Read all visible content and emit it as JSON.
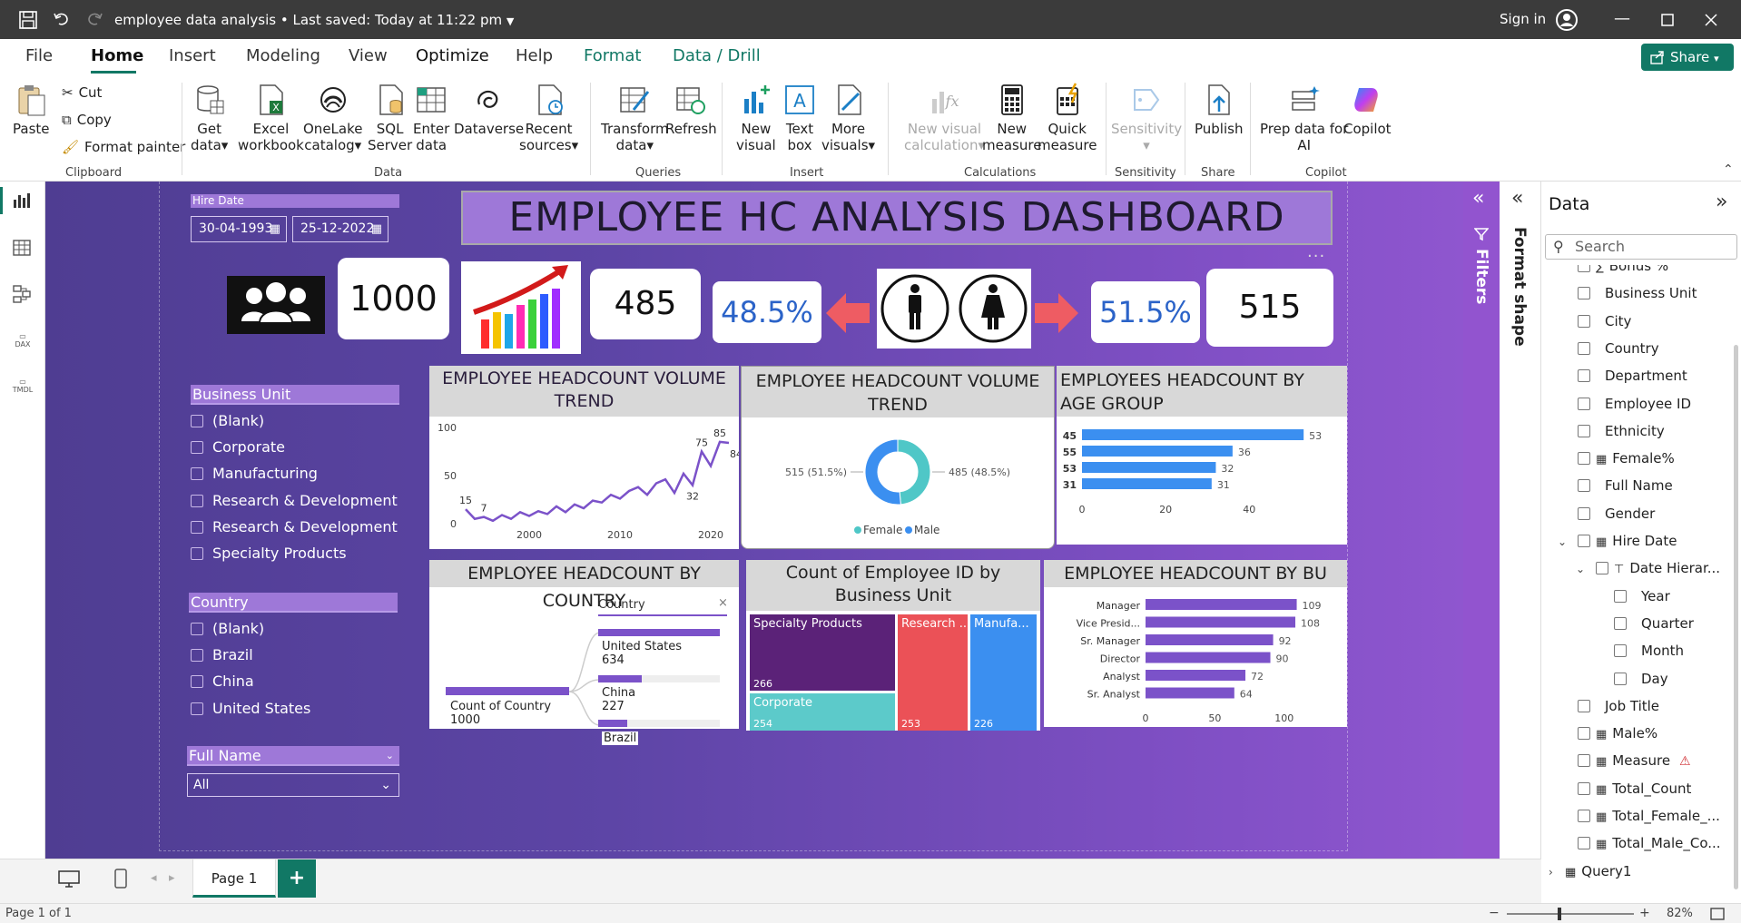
{
  "titlebar": {
    "title": "employee data analysis",
    "saved": "Last saved: Today at 11:22 pm",
    "signin": "Sign in"
  },
  "tabs": [
    "File",
    "Home",
    "Insert",
    "Modeling",
    "View",
    "Optimize",
    "Help",
    "Format",
    "Data / Drill"
  ],
  "share_label": "Share",
  "ribbon": {
    "clipboard": {
      "paste": "Paste",
      "cut": "Cut",
      "copy": "Copy",
      "format_painter": "Format painter",
      "group": "Clipboard"
    },
    "data": {
      "get_data_1": "Get",
      "get_data_2": "data",
      "excel_1": "Excel",
      "excel_2": "workbook",
      "onelake_1": "OneLake",
      "onelake_2": "catalog",
      "sql_1": "SQL",
      "sql_2": "Server",
      "enter_1": "Enter",
      "enter_2": "data",
      "dataverse": "Dataverse",
      "recent_1": "Recent",
      "recent_2": "sources",
      "group": "Data"
    },
    "queries": {
      "transform_1": "Transform",
      "transform_2": "data",
      "refresh": "Refresh",
      "group": "Queries"
    },
    "insert": {
      "newvisual_1": "New",
      "newvisual_2": "visual",
      "textbox_1": "Text",
      "textbox_2": "box",
      "more_1": "More",
      "more_2": "visuals",
      "group": "Insert"
    },
    "calculations": {
      "nvc_1": "New visual",
      "nvc_2": "calculation",
      "nm_1": "New",
      "nm_2": "measure",
      "qm_1": "Quick",
      "qm_2": "measure",
      "group": "Calculations"
    },
    "sensitivity": {
      "label": "Sensitivity",
      "group": "Sensitivity"
    },
    "share": {
      "publish": "Publish",
      "group": "Share"
    },
    "copilot": {
      "prep_1": "Prep data for",
      "prep_2": "AI",
      "copilot": "Copilot",
      "group": "Copilot"
    }
  },
  "dashboard": {
    "title": "EMPLOYEE HC ANALYSIS DASHBOARD",
    "hire_date": {
      "label": "Hire Date",
      "from": "30-04-1993",
      "to": "25-12-2022"
    },
    "kpi": {
      "total": "1000",
      "female": "485",
      "female_pct": "48.5%",
      "male_pct": "51.5%",
      "male": "515"
    },
    "bu_slicer": {
      "title": "Business Unit",
      "items": [
        "(Blank)",
        "Corporate",
        "Manufacturing",
        "Research & Development",
        "Research & Development",
        "Specialty Products"
      ]
    },
    "country_slicer": {
      "title": "Country",
      "items": [
        "(Blank)",
        "Brazil",
        "China",
        "United States"
      ]
    },
    "fullname_slicer": {
      "title": "Full Name",
      "value": "All"
    },
    "v_line_title": "EMPLOYEE HEADCOUNT VOLUME TREND",
    "v_donut_title": "EMPLOYEE HEADCOUNT VOLUME TREND",
    "v_age_title": "EMPLOYEES HEADCOUNT BY AGE GROUP",
    "v_country_title": "EMPLOYEE HEADCOUNT BY COUNTRY",
    "v_treemap_title": "Count of Employee ID by Business Unit",
    "v_bu_title": "EMPLOYEE HEADCOUNT BY BU",
    "decomp": {
      "filter": "Country",
      "root_label": "Count of Country",
      "root_value": "1000",
      "n1_label": "United States",
      "n1_value": "634",
      "n2_label": "China",
      "n2_value": "227",
      "n3_label": "Brazil"
    }
  },
  "chart_data": [
    {
      "type": "line",
      "ylim": [
        0,
        100
      ],
      "yticks": [
        "0",
        "50",
        "100"
      ],
      "xticks": [
        "2000",
        "2010",
        "2020"
      ],
      "x": [
        1993,
        1994,
        1995,
        1996,
        1997,
        1998,
        1999,
        2000,
        2001,
        2002,
        2003,
        2004,
        2005,
        2006,
        2007,
        2008,
        2009,
        2010,
        2011,
        2012,
        2013,
        2014,
        2015,
        2016,
        2017,
        2018,
        2019,
        2020,
        2021,
        2022
      ],
      "values": [
        15,
        5,
        7,
        3,
        9,
        5,
        12,
        8,
        13,
        10,
        18,
        12,
        20,
        16,
        24,
        22,
        30,
        26,
        34,
        38,
        30,
        42,
        46,
        32,
        52,
        40,
        75,
        60,
        85,
        84
      ],
      "labels": [
        {
          "i": 0,
          "text": "15"
        },
        {
          "i": 2,
          "text": "7"
        },
        {
          "i": 25,
          "text": "32"
        },
        {
          "i": 26,
          "text": "75"
        },
        {
          "i": 28,
          "text": "85"
        },
        {
          "i": 29,
          "text": "84"
        }
      ],
      "color": "#7b52c9"
    },
    {
      "type": "pie",
      "hole": true,
      "slices": [
        {
          "name": "Female",
          "value": 485,
          "label": "485 (48.5%)",
          "color": "#4fc7c7"
        },
        {
          "name": "Male",
          "value": 515,
          "label": "515 (51.5%)",
          "color": "#3b8ff0"
        }
      ]
    },
    {
      "type": "bar",
      "orientation": "horizontal",
      "categories": [
        "45",
        "55",
        "53",
        "31"
      ],
      "values": [
        53,
        36,
        32,
        31
      ],
      "xticks": [
        "0",
        "20",
        "40"
      ],
      "xlim": [
        0,
        56
      ],
      "color": "#3b8ff0"
    },
    {
      "type": "heatmap",
      "subtype": "treemap",
      "categories": [
        "Specialty Products",
        "Research ...",
        "Manufa...",
        "Corporate"
      ],
      "values": [
        266,
        253,
        226,
        254
      ],
      "colors": [
        "#5b2278",
        "#eb5157",
        "#3b8ff0",
        "#5ccaca"
      ]
    },
    {
      "type": "bar",
      "orientation": "horizontal",
      "categories": [
        "Manager",
        "Vice Presid...",
        "Sr. Manager",
        "Director",
        "Analyst",
        "Sr. Analyst"
      ],
      "values": [
        109,
        108,
        92,
        90,
        72,
        64
      ],
      "xticks": [
        "0",
        "50",
        "100"
      ],
      "xlim": [
        0,
        125
      ],
      "color": "#7b52c9"
    }
  ],
  "datapane": {
    "title": "Data",
    "search": "Search",
    "fields": [
      {
        "label": "Bonus %",
        "kind": "sigma",
        "indent": 0
      },
      {
        "label": "Business Unit",
        "kind": "",
        "indent": 0
      },
      {
        "label": "City",
        "kind": "",
        "indent": 0
      },
      {
        "label": "Country",
        "kind": "",
        "indent": 0
      },
      {
        "label": "Department",
        "kind": "",
        "indent": 0
      },
      {
        "label": "Employee ID",
        "kind": "",
        "indent": 0
      },
      {
        "label": "Ethnicity",
        "kind": "",
        "indent": 0
      },
      {
        "label": "Female%",
        "kind": "calc",
        "indent": 0
      },
      {
        "label": "Full Name",
        "kind": "",
        "indent": 0
      },
      {
        "label": "Gender",
        "kind": "",
        "indent": 0
      },
      {
        "label": "Hire Date",
        "kind": "table",
        "indent": 0,
        "expand": true
      },
      {
        "label": "Date Hierar...",
        "kind": "hier",
        "indent": 1,
        "expand": true
      },
      {
        "label": "Year",
        "kind": "",
        "indent": 2
      },
      {
        "label": "Quarter",
        "kind": "",
        "indent": 2
      },
      {
        "label": "Month",
        "kind": "",
        "indent": 2
      },
      {
        "label": "Day",
        "kind": "",
        "indent": 2
      },
      {
        "label": "Job Title",
        "kind": "",
        "indent": 0
      },
      {
        "label": "Male%",
        "kind": "calc",
        "indent": 0
      },
      {
        "label": "Measure",
        "kind": "calc",
        "indent": 0,
        "warn": true
      },
      {
        "label": "Total_Count",
        "kind": "calc",
        "indent": 0
      },
      {
        "label": "Total_Female_...",
        "kind": "calc",
        "indent": 0
      },
      {
        "label": "Total_Male_Co...",
        "kind": "calc",
        "indent": 0
      }
    ],
    "query": "Query1"
  },
  "filters_label": "Filters",
  "format_shape_label": "Format shape",
  "page_tab": "Page 1",
  "status": {
    "page": "Page 1 of 1",
    "zoom": "82%"
  },
  "colors": {
    "accent_green": "#117865",
    "canvas": "#5a44a2",
    "filters": "#9254cf"
  }
}
